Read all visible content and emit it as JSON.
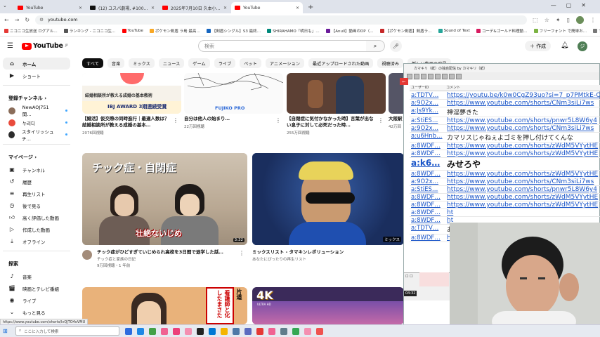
{
  "browser": {
    "tabs": [
      {
        "title": "YouTube",
        "active": false,
        "icon": "youtube-icon"
      },
      {
        "title": "(12) ユスパ劇場, #100円部屋 #号…",
        "active": false,
        "icon": "tiktok-icon"
      },
      {
        "title": "2025年7月10日 久本小太郎がマ…",
        "active": false,
        "icon": "youtube-icon"
      },
      {
        "title": "YouTube",
        "active": true,
        "icon": "youtube-icon"
      }
    ],
    "url": "youtube.com",
    "bookmarks": [
      "ニコニコ生放送 ログアル…",
      "ランキング - ニコニコ生…",
      "YouTube",
      "ポケモン剣盾 ラ島 最高…",
      "【剣盾シングル】S3 最終…",
      "SHIRAHAMO「明日も」…",
      "【Anull】動画のDP（…",
      "【ポケモン剣盾】剣盾ラ…",
      "Sound of Text",
      "コーデ&ゴールド料理動…",
      "フリーフォント で簡単お…",
      "すべてのブックマーク"
    ]
  },
  "youtube": {
    "logo_text": "YouTube",
    "logo_region": "JP",
    "search_placeholder": "検索",
    "create_label": "作成",
    "avatar_letter": "ジ",
    "sidebar": {
      "top": [
        {
          "label": "ホーム",
          "icon": "home-icon",
          "active": true
        },
        {
          "label": "ショート",
          "icon": "shorts-icon"
        }
      ],
      "subs_heading": "登録チャンネル ›",
      "channels": [
        {
          "name": "NewAOJ751 関…",
          "color": "#8a6d5a"
        },
        {
          "name": "누리디",
          "color": "#e94b3c"
        },
        {
          "name": "スタイリッシュチ…",
          "color": "#2c2c2c"
        }
      ],
      "mypage_heading": "マイページ ›",
      "mypage": [
        {
          "label": "チャンネル",
          "icon": "channel-icon"
        },
        {
          "label": "履歴",
          "icon": "history-icon"
        },
        {
          "label": "再生リスト",
          "icon": "playlist-icon"
        },
        {
          "label": "後で見る",
          "icon": "watch-later-icon"
        },
        {
          "label": "高く評価した動画",
          "icon": "thumbs-up-icon"
        },
        {
          "label": "作成した動画",
          "icon": "video-icon"
        },
        {
          "label": "オフライン",
          "icon": "download-icon"
        }
      ],
      "explore_heading": "探索",
      "explore": [
        {
          "label": "音楽",
          "icon": "music-icon"
        },
        {
          "label": "映画とテレビ番組",
          "icon": "movie-icon"
        },
        {
          "label": "ライブ",
          "icon": "live-icon"
        },
        {
          "label": "もっと見る",
          "icon": "chevron-down-icon"
        }
      ]
    },
    "chips": [
      "すべて",
      "音楽",
      "ミックス",
      "ニュース",
      "ゲーム",
      "ライブ",
      "ペット",
      "アニメーション",
      "最近アップロードされた動画",
      "視聴済み",
      "新しい動画の発見"
    ],
    "row1": [
      {
        "title": "【婚活】仮交際の同時進行｜最適人数は？結婚相談所が教える成婚の基本…",
        "meta": "2076回視聴",
        "thumb_text": "結婚相談所が教える成婚の基本教術",
        "badge": "IBJ AWARD 3期連続受賞"
      },
      {
        "title": "自分は他人の始まり…",
        "meta": "22万回視聴",
        "logo": "FUJIKO PRO"
      },
      {
        "title": "【自閉症に気付かなかった時】言葉が出ない息子に対して必死だった時…",
        "meta": "255万回視聴"
      },
      {
        "title": "大阪駅",
        "meta": "42万回"
      }
    ],
    "row2": [
      {
        "title": "チック症がひどすぎていじめられ高校を3日間で退学した話…",
        "channel": "チック症と家族の日記",
        "meta": "9万回視聴・1 年前",
        "thumb_text": "チック症・自閉症",
        "overlay": "壮絶ないじめ",
        "duration": "3:32"
      },
      {
        "title": "ミックスリスト - タマキンレボリューション",
        "channel": "あなたにぴったりの再生リスト",
        "badge": "ミックス"
      }
    ],
    "row3": [
      {
        "thumb_text": "看護師と化したまさた",
        "side_text": "片道"
      },
      {
        "badge": "4K",
        "sub": "ULTRA HD"
      }
    ],
    "status_url": "https://www.youtube.com/shorts/lvQjTO4oVMU"
  },
  "comment_viewer": {
    "title": "カマキリ（紙）の独自配信 by カマキリ（紙）",
    "col_user": "ユーザーID",
    "col_comment": "コメント",
    "rows": [
      {
        "user": "a:TDTV…",
        "comment": "https://youtu.be/k0w0CgZ93uo?si=7_p7PMtkE-Ow",
        "link": true
      },
      {
        "user": "a:9O2x…",
        "comment": "https://www.youtube.com/shorts/CNm3siLi7ws",
        "link": true
      },
      {
        "user": "a:Js9Yk…",
        "comment": "神淫夢きた",
        "link": false
      },
      {
        "user": "a:StiES…",
        "comment": "https://www.youtube.com/shorts/pnwr5L8W6y4",
        "link": true
      },
      {
        "user": "a:9O2x…",
        "comment": "https://www.youtube.com/shorts/CNm3siLi7ws",
        "link": true
      },
      {
        "user": "a:u6Hnb…",
        "comment": "カマリスじゃねぇよゴミを押し付けてくんな",
        "link": false
      },
      {
        "user": "a:8WDF…",
        "comment": "https://www.youtube.com/shorts/zWdM5VYytHE",
        "link": true
      },
      {
        "user": "a:8WDF…",
        "comment": "https://www.youtube.com/shorts/zWdM5VYytHE",
        "link": true
      },
      {
        "user": "a:k6…",
        "comment": "みせろや",
        "link": false,
        "big": true
      },
      {
        "user": "a:8WDF…",
        "comment": "https://www.youtube.com/shorts/zWdM5VYytHE",
        "link": true
      },
      {
        "user": "a:9O2x…",
        "comment": "https://www.youtube.com/shorts/CNm3siLi7ws",
        "link": true
      },
      {
        "user": "a:StiES…",
        "comment": "https://www.youtube.com/shorts/pnwr5L8W6y4",
        "link": true
      },
      {
        "user": "a:8WDF…",
        "comment": "https://www.youtube.com/shorts/zWdM5VYytHE",
        "link": true
      },
      {
        "user": "a:8WDF…",
        "comment": "https://www.youtube.com/shorts/zWdM5VYytHE",
        "link": true
      },
      {
        "user": "a:8WDF…",
        "comment": "ht",
        "link": true
      },
      {
        "user": "a:8WDF…",
        "comment": "ht",
        "link": true
      },
      {
        "user": "a:TDTV…",
        "comment": "あ",
        "link": false
      },
      {
        "user": "a:8WDF…",
        "comment": "ht",
        "link": true
      }
    ],
    "time": "04:32"
  },
  "taskbar": {
    "search_placeholder": "ここに入力して検索",
    "apps": [
      "#2d6cdf",
      "#1e88e5",
      "#43a047",
      "#f06292",
      "#ec407a",
      "#f48fb1",
      "#222222",
      "#0078d4",
      "#f4b400",
      "#4e79a7",
      "#5c6bc0",
      "#e53935",
      "#f06292",
      "#607d8b",
      "#34a853",
      "#f48fb1",
      "#ef5350"
    ]
  }
}
